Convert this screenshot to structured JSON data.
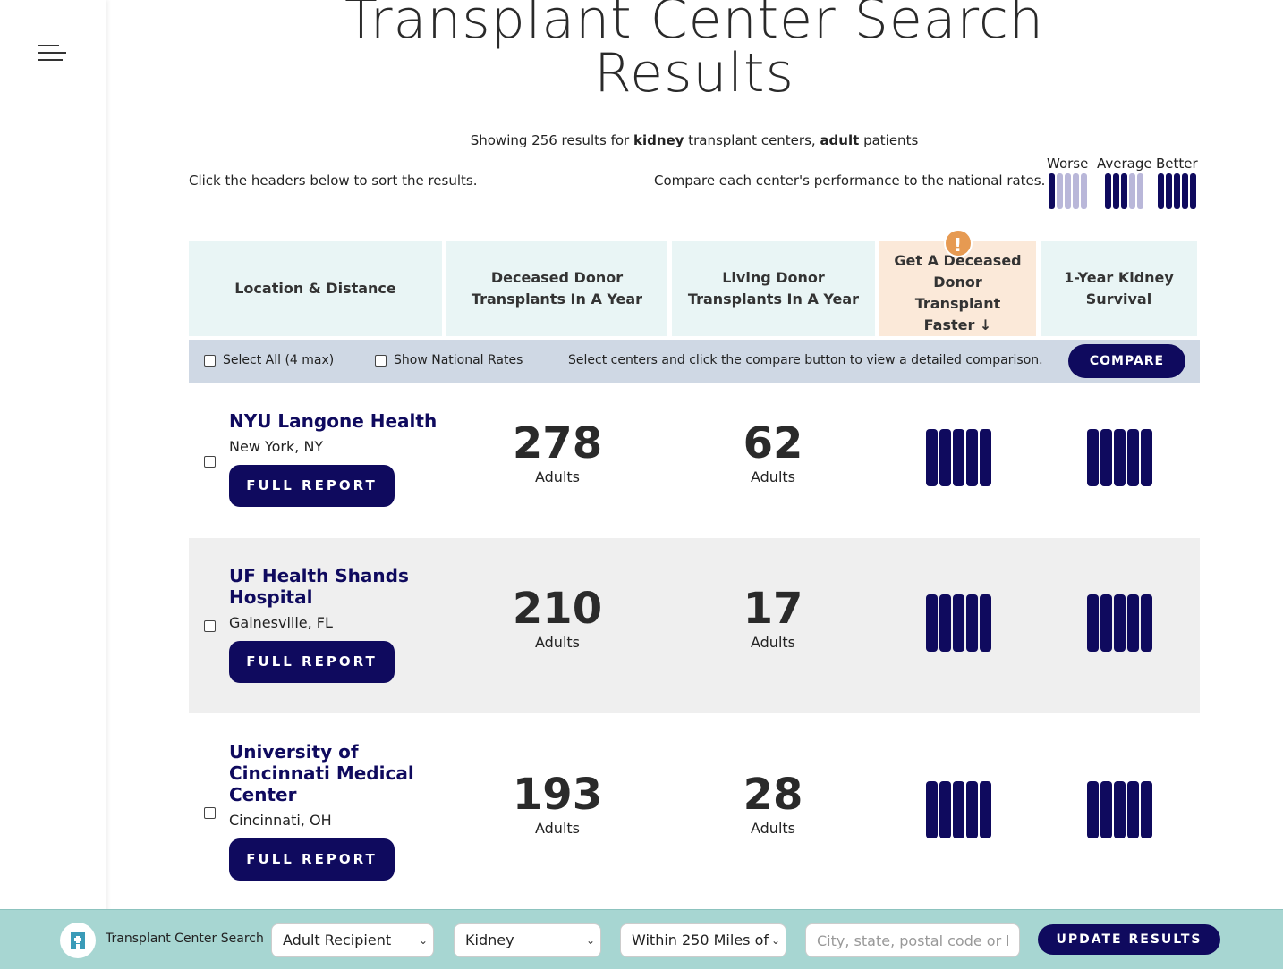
{
  "page": {
    "title": "Transplant Center Search Results",
    "summary": {
      "prefix": "Showing 256 results for ",
      "organ": "kidney",
      "mid": " transplant centers, ",
      "patient": "adult",
      "suffix": " patients"
    },
    "sort_hint": "Click the headers below to sort the results.",
    "compare_hint": "Compare each center's performance to the national rates."
  },
  "legend": {
    "items": [
      {
        "label": "Worse",
        "level": 1
      },
      {
        "label": "Average",
        "level": 3
      },
      {
        "label": "Better",
        "level": 5
      }
    ]
  },
  "columns": [
    {
      "label": "Location & Distance"
    },
    {
      "label": "Deceased Donor Transplants In A Year"
    },
    {
      "label": "Living Donor Transplants In A Year"
    },
    {
      "label": "Get A Deceased Donor Transplant Faster ↓",
      "alert_icon": "!"
    },
    {
      "label": "1-Year Kidney Survival"
    }
  ],
  "toolbar": {
    "select_all": "Select All (4 max)",
    "show_national": "Show National Rates",
    "hint": "Select centers and click the compare button to view a detailed comparison.",
    "compare_label": "COMPARE"
  },
  "centers": [
    {
      "name": "NYU Langone Health",
      "location": "New York, NY",
      "report_label": "FULL REPORT",
      "deceased": "278",
      "deceased_unit": "Adults",
      "living": "62",
      "living_unit": "Adults",
      "faster_rating": 5,
      "survival_rating": 5
    },
    {
      "name": "UF Health Shands Hospital",
      "location": "Gainesville, FL",
      "report_label": "FULL REPORT",
      "deceased": "210",
      "deceased_unit": "Adults",
      "living": "17",
      "living_unit": "Adults",
      "faster_rating": 5,
      "survival_rating": 5
    },
    {
      "name": "University of Cincinnati Medical Center",
      "location": "Cincinnati, OH",
      "report_label": "FULL REPORT",
      "deceased": "193",
      "deceased_unit": "Adults",
      "living": "28",
      "living_unit": "Adults",
      "faster_rating": 5,
      "survival_rating": 5
    }
  ],
  "footer": {
    "label": "Transplant Center Search",
    "recipient": "Adult Recipient",
    "organ": "Kidney",
    "distance": "Within 250 Miles of",
    "location_placeholder": "City, state, postal code or location",
    "update_label": "UPDATE RESULTS"
  },
  "colors": {
    "primary": "#0f0a5e",
    "light_bar": "#b9b7d9",
    "header_bg": "#e9f5f5",
    "active_header_bg": "#fbe9d9",
    "footer_bg": "#a7d6d2",
    "alert": "#e69a52"
  }
}
